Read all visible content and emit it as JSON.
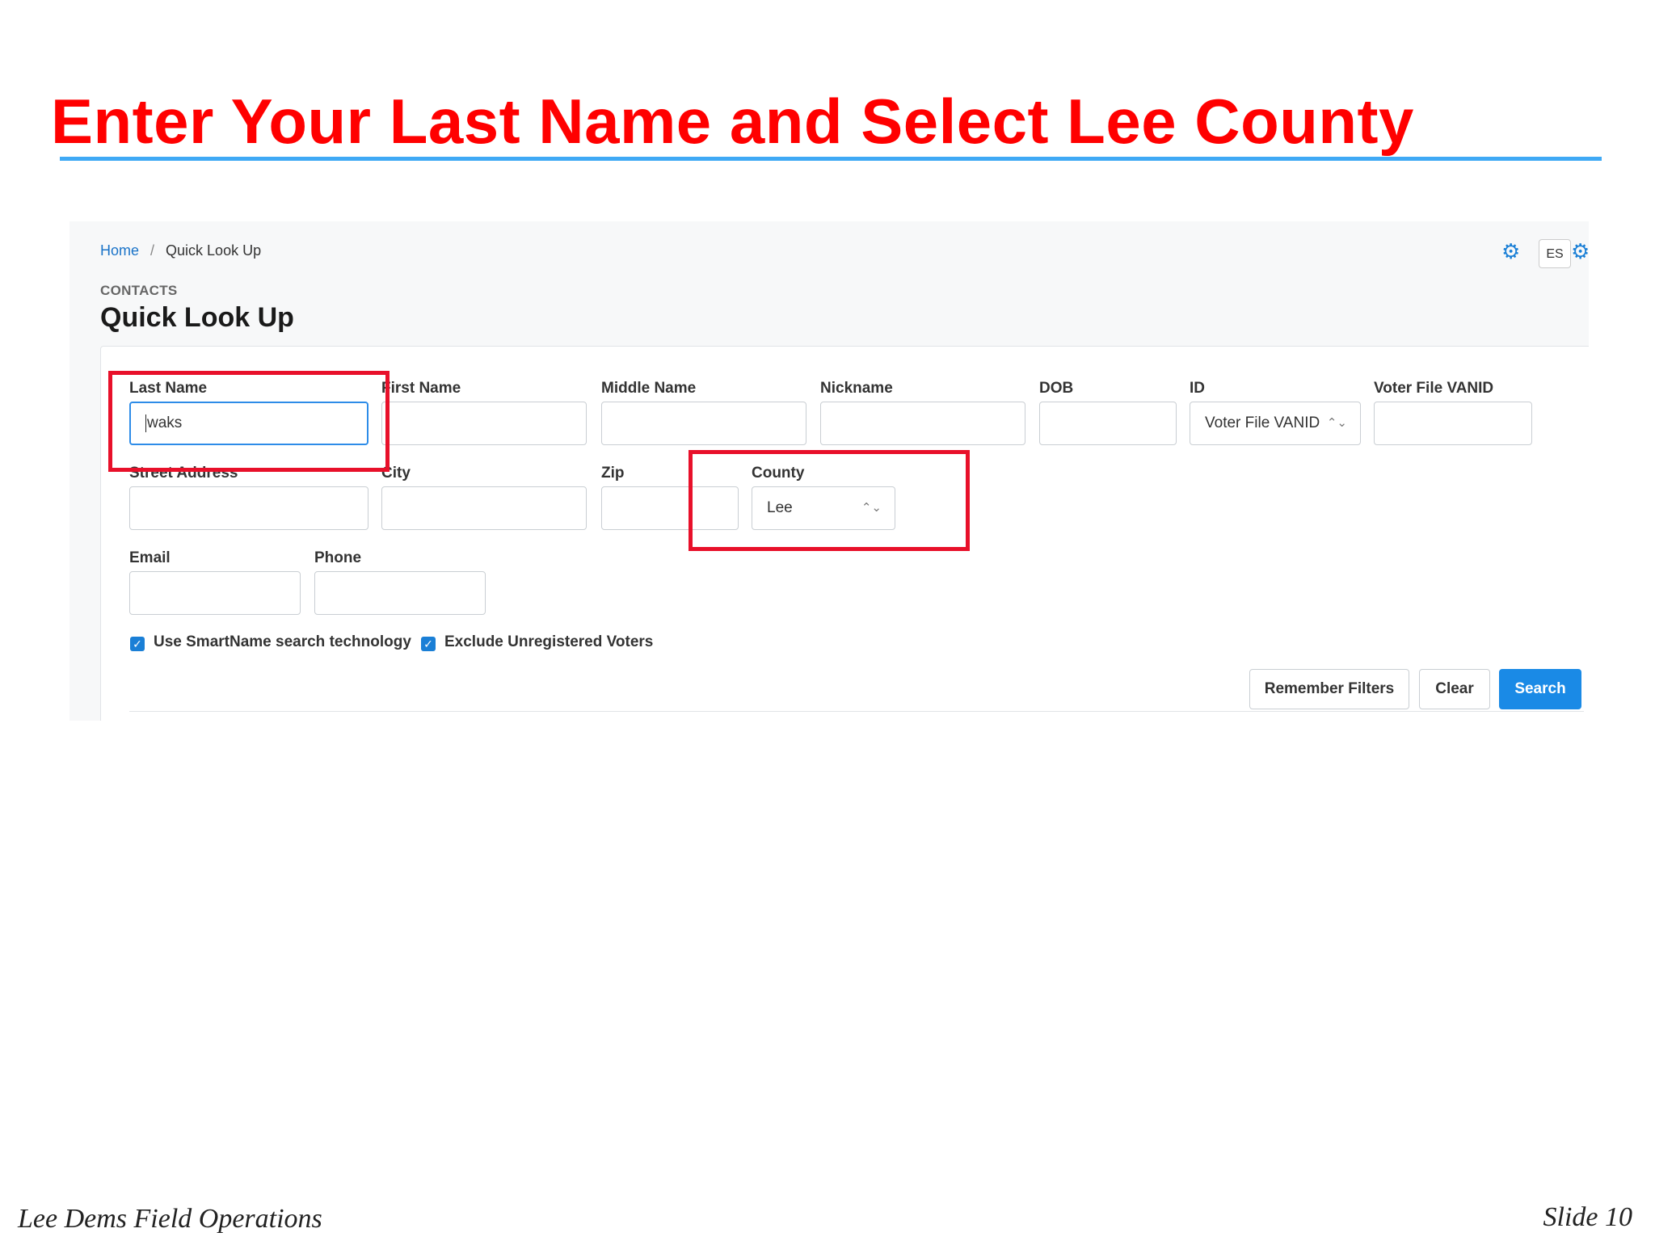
{
  "slide": {
    "title": "Enter Your Last Name and Select Lee County",
    "footer_left": "Lee Dems Field Operations",
    "footer_right": "Slide 10"
  },
  "breadcrumb": {
    "home": "Home",
    "separator": "/",
    "current": "Quick Look Up"
  },
  "header": {
    "section": "CONTACTS",
    "title": "Quick Look Up",
    "language_button": "ES",
    "settings_icon": "gear-icon"
  },
  "form": {
    "last_name": {
      "label": "Last Name",
      "value": "waks"
    },
    "first_name": {
      "label": "First Name",
      "value": ""
    },
    "middle_name": {
      "label": "Middle Name",
      "value": ""
    },
    "nickname": {
      "label": "Nickname",
      "value": ""
    },
    "dob": {
      "label": "DOB",
      "value": ""
    },
    "id": {
      "label": "ID",
      "value": "Voter File VANID"
    },
    "voter_file_vanid": {
      "label": "Voter File VANID",
      "value": ""
    },
    "street_address": {
      "label": "Street Address",
      "value": ""
    },
    "city": {
      "label": "City",
      "value": ""
    },
    "zip": {
      "label": "Zip",
      "value": ""
    },
    "county": {
      "label": "County",
      "value": "Lee"
    },
    "email": {
      "label": "Email",
      "value": ""
    },
    "phone": {
      "label": "Phone",
      "value": ""
    },
    "smartname": {
      "label": "Use SmartName search technology",
      "checked": true
    },
    "exclude_unregistered": {
      "label": "Exclude Unregistered Voters",
      "checked": true
    }
  },
  "actions": {
    "remember_filters": "Remember Filters",
    "clear": "Clear",
    "search": "Search"
  },
  "colors": {
    "title": "#ff0000",
    "title_rule": "#3fa9f5",
    "highlight_box": "#e8102a",
    "primary_button": "#1a8ae6"
  }
}
